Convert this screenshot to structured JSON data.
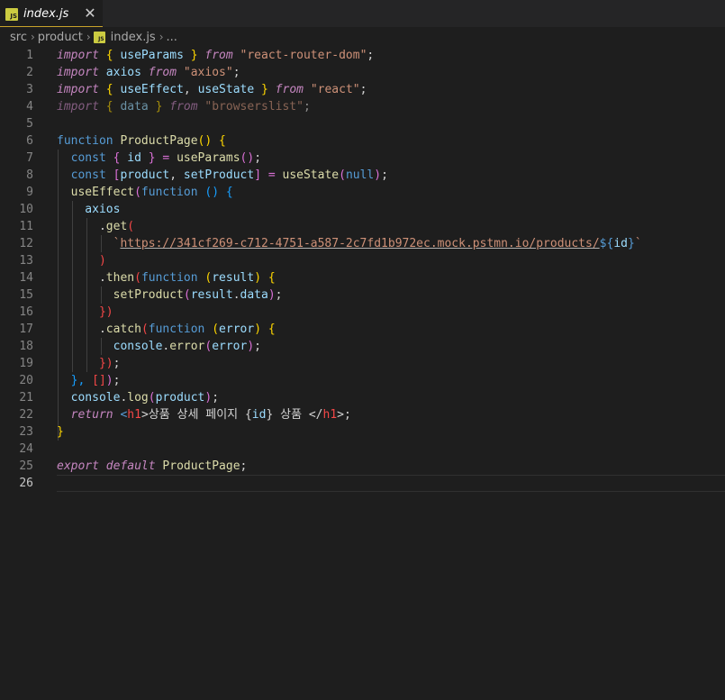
{
  "tab": {
    "label": "index.js",
    "badge": "JS",
    "close": "✕"
  },
  "breadcrumb": {
    "items": [
      "src",
      "product",
      "index.js",
      "..."
    ],
    "badge": "JS"
  },
  "editor": {
    "current_line": 26,
    "lines": [
      {
        "n": "1"
      },
      {
        "n": "2"
      },
      {
        "n": "3"
      },
      {
        "n": "4"
      },
      {
        "n": "5"
      },
      {
        "n": "6"
      },
      {
        "n": "7"
      },
      {
        "n": "8"
      },
      {
        "n": "9"
      },
      {
        "n": "10"
      },
      {
        "n": "11"
      },
      {
        "n": "12"
      },
      {
        "n": "13"
      },
      {
        "n": "14"
      },
      {
        "n": "15"
      },
      {
        "n": "16"
      },
      {
        "n": "17"
      },
      {
        "n": "18"
      },
      {
        "n": "19"
      },
      {
        "n": "20"
      },
      {
        "n": "21"
      },
      {
        "n": "22"
      },
      {
        "n": "23"
      },
      {
        "n": "24"
      },
      {
        "n": "25"
      },
      {
        "n": "26"
      }
    ],
    "code": {
      "l1": [
        "import",
        " { ",
        "useParams",
        " } ",
        "from",
        " ",
        "\"react-router-dom\"",
        ";"
      ],
      "l2": [
        "import",
        " ",
        "axios",
        " ",
        "from",
        " ",
        "\"axios\"",
        ";"
      ],
      "l3": [
        "import",
        " { ",
        "useEffect",
        ", ",
        "useState",
        " } ",
        "from",
        " ",
        "\"react\"",
        ";"
      ],
      "l4": [
        "import",
        " { ",
        "data",
        " } ",
        "from",
        " ",
        "\"browserslist\"",
        ";"
      ],
      "l6": [
        "function",
        " ",
        "ProductPage",
        "() {"
      ],
      "l7": [
        "  const",
        " { ",
        "id",
        " } = ",
        "useParams",
        "()",
        ";"
      ],
      "l8": [
        "  const",
        " [",
        "product",
        ", ",
        "setProduct",
        "] = ",
        "useState",
        "(",
        "null",
        ")",
        ";"
      ],
      "l9": [
        "  useEffect",
        "(",
        "function",
        " () {"
      ],
      "l10": [
        "    axios"
      ],
      "l11": [
        "      .",
        "get",
        "("
      ],
      "l12": [
        "        `",
        "https://341cf269-c712-4751-a587-2c7fd1b972ec.mock.pstmn.io/products/",
        "${",
        "id",
        "}",
        "`"
      ],
      "l13": [
        "      )"
      ],
      "l14": [
        "      .",
        "then",
        "(",
        "function",
        " (",
        "result",
        ") {"
      ],
      "l15": [
        "        setProduct",
        "(",
        "result",
        ".",
        "data",
        ")",
        ";"
      ],
      "l16": [
        "      })"
      ],
      "l17": [
        "      .",
        "catch",
        "(",
        "function",
        " (",
        "error",
        ") {"
      ],
      "l18": [
        "        console",
        ".",
        "error",
        "(",
        "error",
        ")",
        ";"
      ],
      "l19": [
        "      })",
        ";"
      ],
      "l20": [
        "  }, ",
        "[]",
        ")",
        ";"
      ],
      "l21": [
        "  console",
        ".",
        "log",
        "(",
        "product",
        ")",
        ";"
      ],
      "l22": [
        "  return",
        " <",
        "h1",
        ">상품 상세 페이지 {",
        "id",
        "} 상품 </",
        "h1",
        ">;"
      ],
      "l23": [
        "}"
      ],
      "l25": [
        "export",
        " ",
        "default",
        " ",
        "ProductPage",
        ";"
      ]
    }
  },
  "colors": {
    "background": "#1e1e1e",
    "keyword": "#569cd6",
    "control": "#c586c0",
    "function": "#dcdcaa",
    "variable": "#9cdcfe",
    "string": "#ce9178",
    "bracket_gold": "#ffd700",
    "bracket_orchid": "#da70d6",
    "bracket_blue": "#179fff",
    "js_badge": "#cbcb41"
  },
  "icons": {
    "tab": "javascript-file-icon",
    "close": "close-icon",
    "breadcrumb_file": "javascript-file-icon",
    "breadcrumb_separator": "chevron-right-icon"
  }
}
